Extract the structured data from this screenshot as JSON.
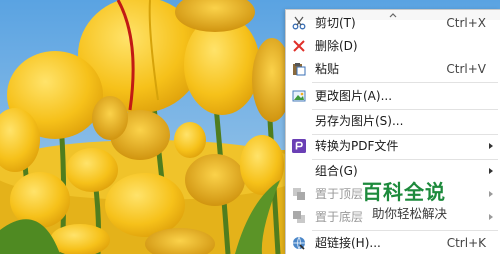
{
  "menu": {
    "items": [
      {
        "label": "剪切(T)",
        "shortcut": "Ctrl+X",
        "icon": "scissors-icon",
        "enabled": true
      },
      {
        "label": "删除(D)",
        "shortcut": "",
        "icon": "delete-x-icon",
        "enabled": true
      },
      {
        "label": "粘贴",
        "shortcut": "Ctrl+V",
        "icon": "paste-icon",
        "enabled": true
      },
      {
        "label": "更改图片(A)...",
        "shortcut": "",
        "icon": "change-picture-icon",
        "enabled": true
      },
      {
        "label": "另存为图片(S)...",
        "shortcut": "",
        "icon": "",
        "enabled": true
      },
      {
        "label": "转换为PDF文件",
        "shortcut": "",
        "icon": "pdf-icon",
        "enabled": true,
        "submenu": true
      },
      {
        "label": "组合(G)",
        "shortcut": "",
        "icon": "",
        "enabled": true,
        "submenu": true
      },
      {
        "label": "置于顶层",
        "shortcut": "",
        "icon": "bring-to-front-icon",
        "enabled": false,
        "submenu": true
      },
      {
        "label": "置于底层",
        "shortcut": "",
        "icon": "send-to-back-icon",
        "enabled": false,
        "submenu": true
      },
      {
        "label": "超链接(H)...",
        "shortcut": "Ctrl+K",
        "icon": "hyperlink-icon",
        "enabled": true
      }
    ]
  },
  "watermark": {
    "title": "百科全说",
    "subtitle": "助你轻松解决"
  },
  "colors": {
    "delete_red": "#e0302a",
    "pdf_purple": "#6a3fb5",
    "watermark_green": "#1d8a3c",
    "tulip_yellow": "#f7c21b",
    "sky_blue": "#7fb6e6"
  }
}
